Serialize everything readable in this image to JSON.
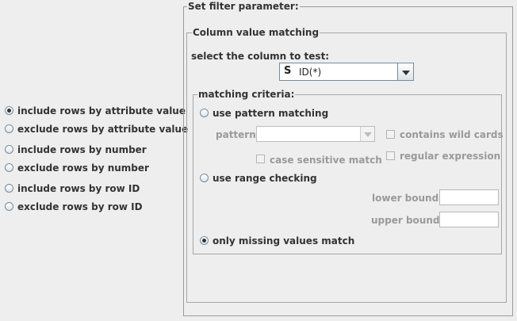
{
  "mode_options": [
    {
      "label": "include rows by attribute value",
      "selected": true
    },
    {
      "label": "exclude rows by attribute value",
      "selected": false
    },
    {
      "label": "include rows by number",
      "selected": false
    },
    {
      "label": "exclude rows by number",
      "selected": false
    },
    {
      "label": "include rows by row ID",
      "selected": false
    },
    {
      "label": "exclude rows by row ID",
      "selected": false
    }
  ],
  "filter_panel": {
    "title": "Set filter parameter:",
    "column_matching": {
      "title": "Column value matching",
      "select_label": "select the column to test:",
      "column_type_icon": "S",
      "column_value": "ID(*)"
    },
    "criteria": {
      "title": "matching criteria:",
      "pattern_option": "use pattern matching",
      "pattern_label": "pattern:",
      "pattern_value": "",
      "contains_wildcards": "contains wild cards",
      "case_sensitive": "case sensitive match",
      "regular_expression": "regular expression",
      "range_option": "use range checking",
      "lower_bound_label": "lower bound:",
      "lower_bound_value": "",
      "upper_bound_label": "upper bound:",
      "upper_bound_value": "",
      "missing_option": "only missing values match",
      "selected_option": "missing"
    }
  },
  "icons": {
    "column_type": "string-type-icon",
    "dropdown": "chevron-down-icon"
  }
}
